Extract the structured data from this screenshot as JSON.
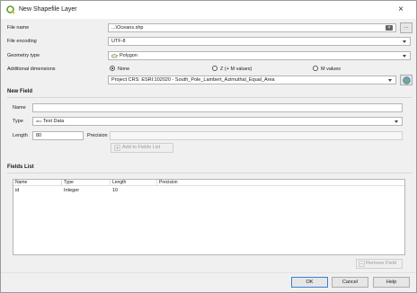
{
  "window": {
    "title": "New Shapefile Layer"
  },
  "file_name": {
    "label": "File name",
    "value": "...\\Oceans.shp"
  },
  "file_encoding": {
    "label": "File encoding",
    "value": "UTF-8"
  },
  "geometry_type": {
    "label": "Geometry type",
    "value": "Polygon"
  },
  "dimensions": {
    "label": "Additional dimensions",
    "options": [
      "None",
      "Z (+ M values)",
      "M values"
    ],
    "selected": "None"
  },
  "crs": {
    "value": "Project CRS: ESRI:102020 - South_Pole_Lambert_Azimuthal_Equal_Area"
  },
  "new_field": {
    "heading": "New Field",
    "name_label": "Name",
    "name_value": "",
    "type_label": "Type",
    "type_prefix": "abc",
    "type_value": "Text Data",
    "length_label": "Length",
    "length_value": "80",
    "precision_label": "Precision",
    "precision_value": "",
    "add_button": "Add to Fields List"
  },
  "fields_list": {
    "heading": "Fields List",
    "columns": [
      "Name",
      "Type",
      "Length",
      "Precision"
    ],
    "rows": [
      {
        "name": "id",
        "type": "Integer",
        "length": "10",
        "precision": ""
      }
    ],
    "remove_button": "Remove Field"
  },
  "footer": {
    "ok": "OK",
    "cancel": "Cancel",
    "help": "Help"
  }
}
